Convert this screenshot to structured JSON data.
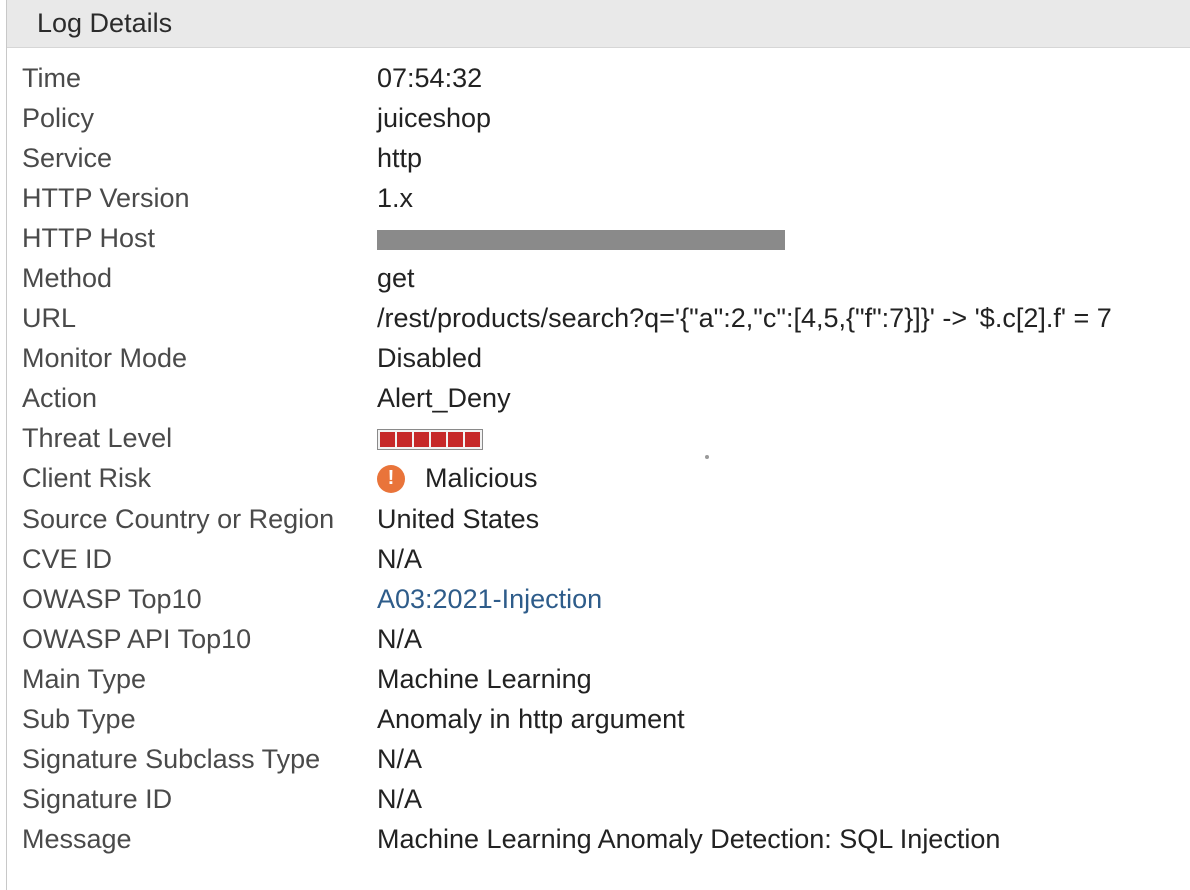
{
  "header": {
    "title": "Log Details"
  },
  "rows": [
    {
      "label": "Time",
      "value": "07:54:32"
    },
    {
      "label": "Policy",
      "value": "juiceshop"
    },
    {
      "label": "Service",
      "value": "http"
    },
    {
      "label": "HTTP Version",
      "value": "1.x"
    },
    {
      "label": "HTTP Host",
      "value": ""
    },
    {
      "label": "Method",
      "value": "get"
    },
    {
      "label": "URL",
      "value": "/rest/products/search?q='{\"a\":2,\"c\":[4,5,{\"f\":7}]}' -> '$.c[2].f' = 7"
    },
    {
      "label": "Monitor Mode",
      "value": "Disabled"
    },
    {
      "label": "Action",
      "value": "Alert_Deny"
    },
    {
      "label": "Threat Level",
      "value": ""
    },
    {
      "label": "Client Risk",
      "value": "Malicious"
    },
    {
      "label": "Source Country or Region",
      "value": "United States"
    },
    {
      "label": "CVE ID",
      "value": "N/A"
    },
    {
      "label": "OWASP Top10",
      "value": "A03:2021-Injection"
    },
    {
      "label": "OWASP API Top10",
      "value": "N/A"
    },
    {
      "label": "Main Type",
      "value": "Machine Learning"
    },
    {
      "label": "Sub Type",
      "value": "Anomaly in http argument"
    },
    {
      "label": "Signature Subclass Type",
      "value": "N/A"
    },
    {
      "label": "Signature ID",
      "value": "N/A"
    },
    {
      "label": "Message",
      "value": "Machine Learning Anomaly Detection: SQL Injection"
    }
  ],
  "threat_level": {
    "filled": 6,
    "total": 6,
    "color": "#c62828"
  },
  "client_risk": {
    "icon": "warning-circle-icon",
    "icon_glyph": "!",
    "color": "#e9743a"
  },
  "colors": {
    "link": "#2e5c8a",
    "header_bg": "#e9e9e9"
  }
}
